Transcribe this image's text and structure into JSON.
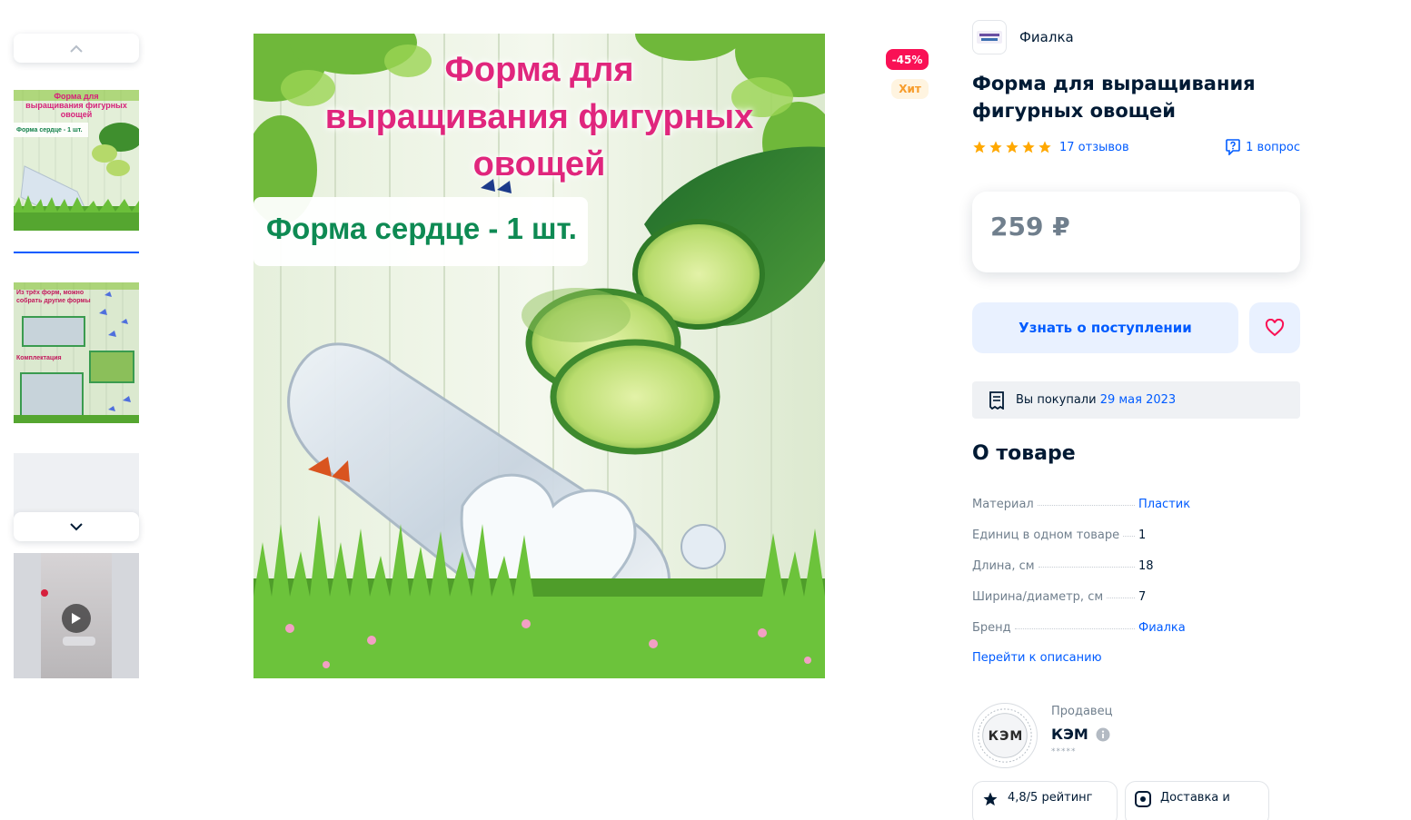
{
  "badges": {
    "sale": "-45%",
    "hit": "Хит"
  },
  "product": {
    "brand": "Фиалка",
    "title": "Форма для выращивания фигурных овощей",
    "reviews": "17 отзывов",
    "questions": "1 вопрос",
    "rating_stars": 5,
    "price": "259 ₽"
  },
  "main_image": {
    "headline_line1": "Форма для",
    "headline_line2": "выращивания фигурных",
    "headline_line3": "овощей",
    "subtitle": "Форма сердце - 1 шт."
  },
  "thumbnails": [
    {
      "line1": "Форма для",
      "line2": "выращивания фигурных",
      "line3": "овощей",
      "caption": "Форма сердце - 1 шт."
    },
    {
      "line1": "Из трёх форм, можно",
      "line2": "собрать другие формы",
      "caption": "Комплектация"
    }
  ],
  "actions": {
    "notify": "Узнать о поступлении"
  },
  "purchase": {
    "label": "Вы покупали",
    "date": "29 мая 2023"
  },
  "about": {
    "title": "О товаре",
    "specs": [
      {
        "name": "Материал",
        "value": "Пластик",
        "link": true
      },
      {
        "name": "Единиц в одном товаре",
        "value": "1",
        "link": false
      },
      {
        "name": "Длина, см",
        "value": "18",
        "link": false
      },
      {
        "name": "Ширина/диаметр, см",
        "value": "7",
        "link": false
      },
      {
        "name": "Бренд",
        "value": "Фиалка",
        "link": true
      }
    ],
    "goto_description": "Перейти к описанию"
  },
  "seller": {
    "label": "Продавец",
    "name": "КЭМ",
    "logo_text": "КЭМ",
    "sub": "*****"
  },
  "chips": [
    {
      "label": "4,8/5 рейтинг"
    },
    {
      "label": "Доставка и"
    }
  ],
  "colors": {
    "accent": "#005bff",
    "sale": "#f91155",
    "star": "#ffa800"
  }
}
